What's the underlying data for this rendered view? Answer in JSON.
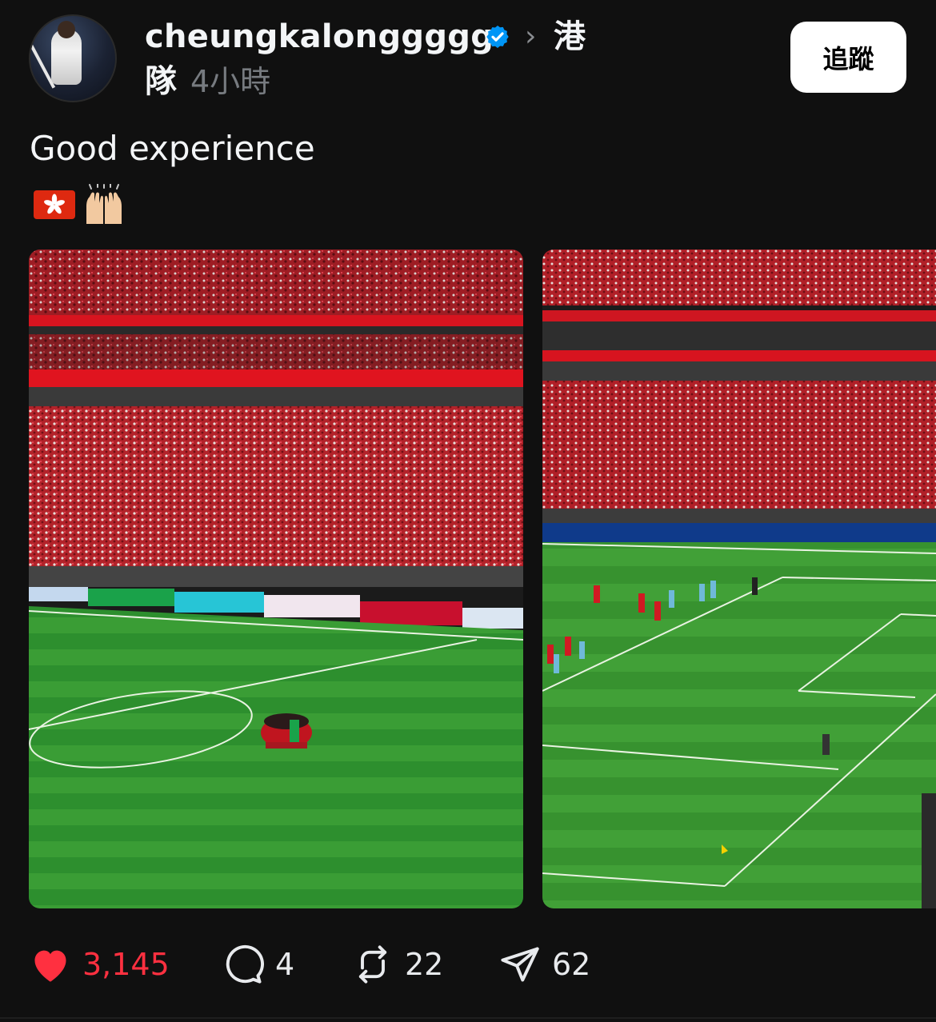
{
  "post": {
    "username": "cheungkalonggggg",
    "topic_line1": "港",
    "topic_line2": "隊",
    "timestamp": "4小時",
    "follow_label": "追蹤",
    "caption": "Good experience",
    "emoji_flag": "hong-kong-flag",
    "emoji_hands": "raising-hands"
  },
  "actions": {
    "likes": "3,145",
    "comments": "4",
    "reposts": "22",
    "shares": "62"
  },
  "colors": {
    "background": "#101010",
    "like_red": "#ff3040",
    "verified_blue": "#0095f6",
    "muted": "#777b80"
  },
  "icons": [
    "verified-badge-icon",
    "chevron-right-icon",
    "heart-icon",
    "comment-icon",
    "repost-icon",
    "share-icon"
  ]
}
